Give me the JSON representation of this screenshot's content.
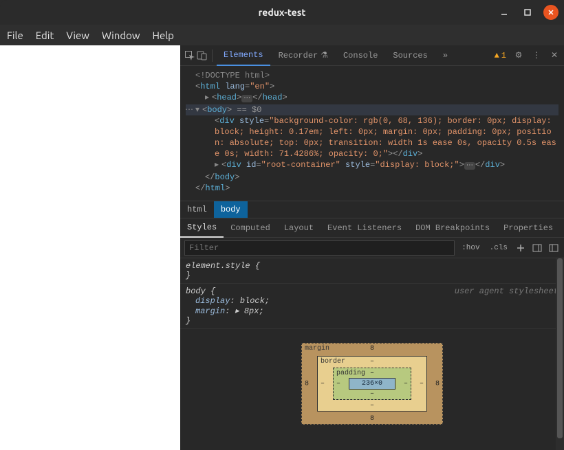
{
  "titlebar": {
    "title": "redux-test"
  },
  "menubar": {
    "items": [
      "File",
      "Edit",
      "View",
      "Window",
      "Help"
    ]
  },
  "devtools": {
    "tabs": {
      "elements": "Elements",
      "recorder": "Recorder",
      "console": "Console",
      "sources": "Sources",
      "more": "»"
    },
    "warnings_count": "1",
    "dom": {
      "doctype": "<!DOCTYPE html>",
      "html_open": {
        "tag": "html",
        "attr": "lang",
        "val": "\"en\""
      },
      "head": {
        "tag": "head"
      },
      "body_tag": "body",
      "body_eq": " == $0",
      "div1_style": "\"background-color: rgb(0, 68, 136); border: 0px; display: block; height: 0.17em; left: 0px; margin: 0px; padding: 0px; position: absolute; top: 0px; transition: width 1s ease 0s, opacity 0.5s ease 0s; width: 71.4286%; opacity: 0;\"",
      "div2_id": "\"root-container\"",
      "div2_style": "\"display: block;\"",
      "body_close": "body",
      "html_close": "html"
    },
    "crumbs": {
      "html": "html",
      "body": "body"
    },
    "styles_tabs": {
      "styles": "Styles",
      "computed": "Computed",
      "layout": "Layout",
      "listeners": "Event Listeners",
      "dombp": "DOM Breakpoints",
      "props": "Properties",
      "more": "»"
    },
    "filter_placeholder": "Filter",
    "hov": ":hov",
    "cls": ".cls",
    "rules": {
      "element_style": "element.style {",
      "close": "}",
      "body_sel": "body {",
      "uas": "user agent stylesheet",
      "display_prop": "display",
      "display_val": ": block;",
      "margin_prop": "margin",
      "margin_val": ": ▸ 8px;"
    },
    "boxmodel": {
      "margin_label": "margin",
      "border_label": "border",
      "padding_label": "padding",
      "content": "236×0",
      "m_t": "8",
      "m_b": "8",
      "m_l": "8",
      "m_r": "8",
      "b_t": "–",
      "b_b": "–",
      "b_l": "–",
      "b_r": "–",
      "p_t": "–",
      "p_b": "–",
      "p_l": "–",
      "p_r": "–"
    }
  }
}
